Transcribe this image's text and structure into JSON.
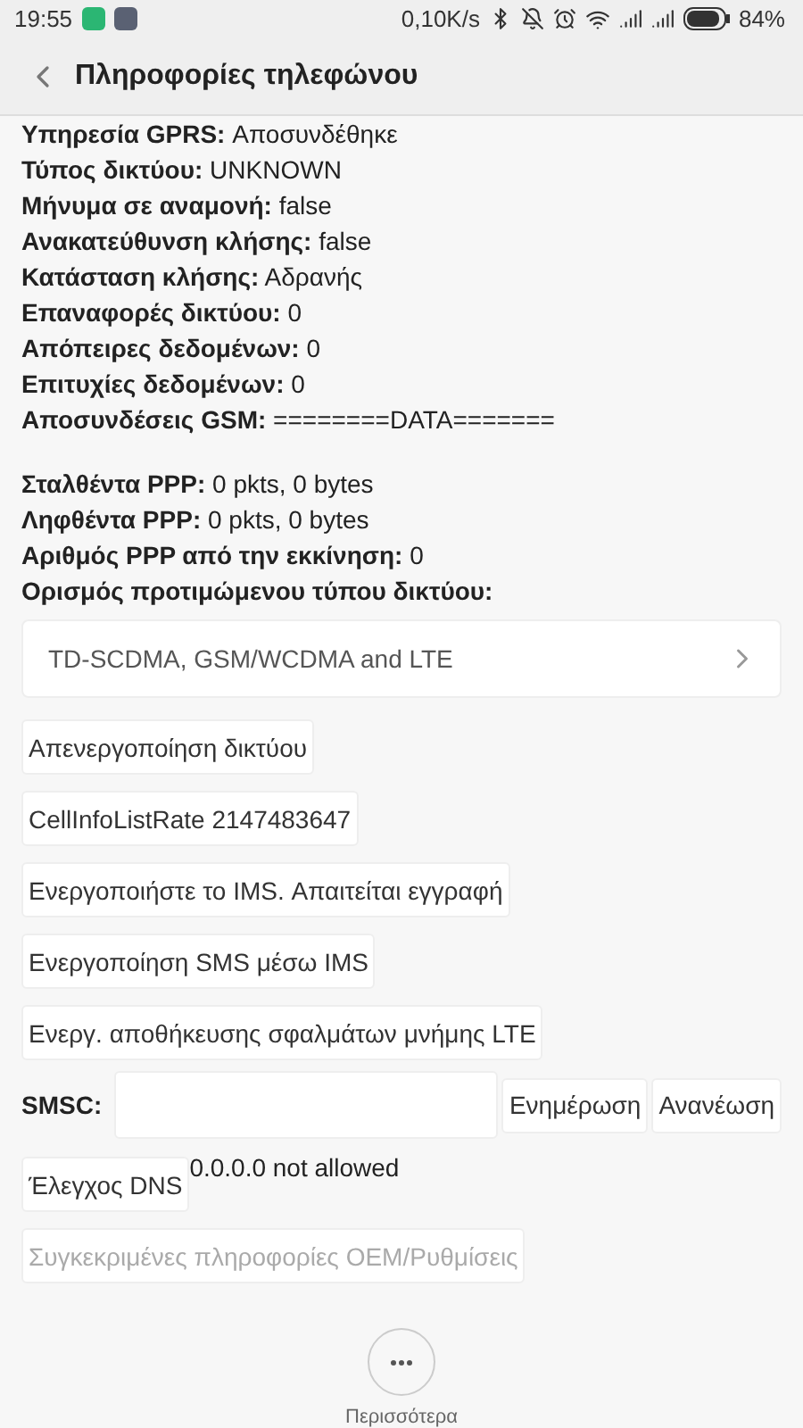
{
  "status_bar": {
    "time": "19:55",
    "speed": "0,10K/s",
    "battery_percent": "84%"
  },
  "header": {
    "title": "Πληροφορίες τηλεφώνου"
  },
  "info_rows": [
    {
      "text": "**Υπηρεσία GPRS:** Αποσυνδέθηκε"
    },
    {
      "text": "**Τύπος δικτύου:** UNKNOWN"
    },
    {
      "text": "**Μήνυμα σε αναμονή:** false"
    },
    {
      "text": "**Ανακατεύθυνση κλήσης:** false"
    },
    {
      "text": "**Κατάσταση κλήσης:** Αδρανής"
    },
    {
      "text": "**Επαναφορές δικτύου:** 0"
    },
    {
      "text": "**Απόπειρες δεδομένων:** 0"
    },
    {
      "text": "**Επιτυχίες δεδομένων:** 0"
    },
    {
      "text": "**Αποσυνδέσεις GSM:** ========DATA======="
    }
  ],
  "ppp_rows": [
    {
      "text": "**Σταλθέντα PPP:** 0 pkts, 0 bytes"
    },
    {
      "text": "**Ληφθέντα PPP:** 0 pkts, 0 bytes"
    },
    {
      "text": "**Αριθμός PPP από την εκκίνηση:** 0"
    }
  ],
  "network_type": {
    "label": "Ορισμός προτιμώμενου τύπου δικτύου:",
    "value": "TD-SCDMA, GSM/WCDMA and LTE"
  },
  "buttons": [
    {
      "label": "Απενεργοποίηση δικτύου",
      "disabled": false
    },
    {
      "label": "CellInfoListRate 2147483647",
      "disabled": false
    },
    {
      "label": "Ενεργοποιήστε το IMS. Απαιτείται εγγραφή",
      "disabled": false
    },
    {
      "label": "Ενεργοποίηση SMS μέσω IMS",
      "disabled": false
    },
    {
      "label": "Ενεργ. αποθήκευσης σφαλμάτων μνήμης LTE",
      "disabled": false
    }
  ],
  "smsc": {
    "label": "SMSC:",
    "update": "Ενημέρωση",
    "refresh": "Ανανέωση"
  },
  "dns": {
    "button": "Έλεγχος DNS",
    "result": "0.0.0.0 not allowed"
  },
  "oem_button": {
    "label": "Συγκεκριμένες πληροφορίες OEM/Ρυθμίσεις",
    "disabled": true
  },
  "more": {
    "label": "Περισσότερα"
  }
}
